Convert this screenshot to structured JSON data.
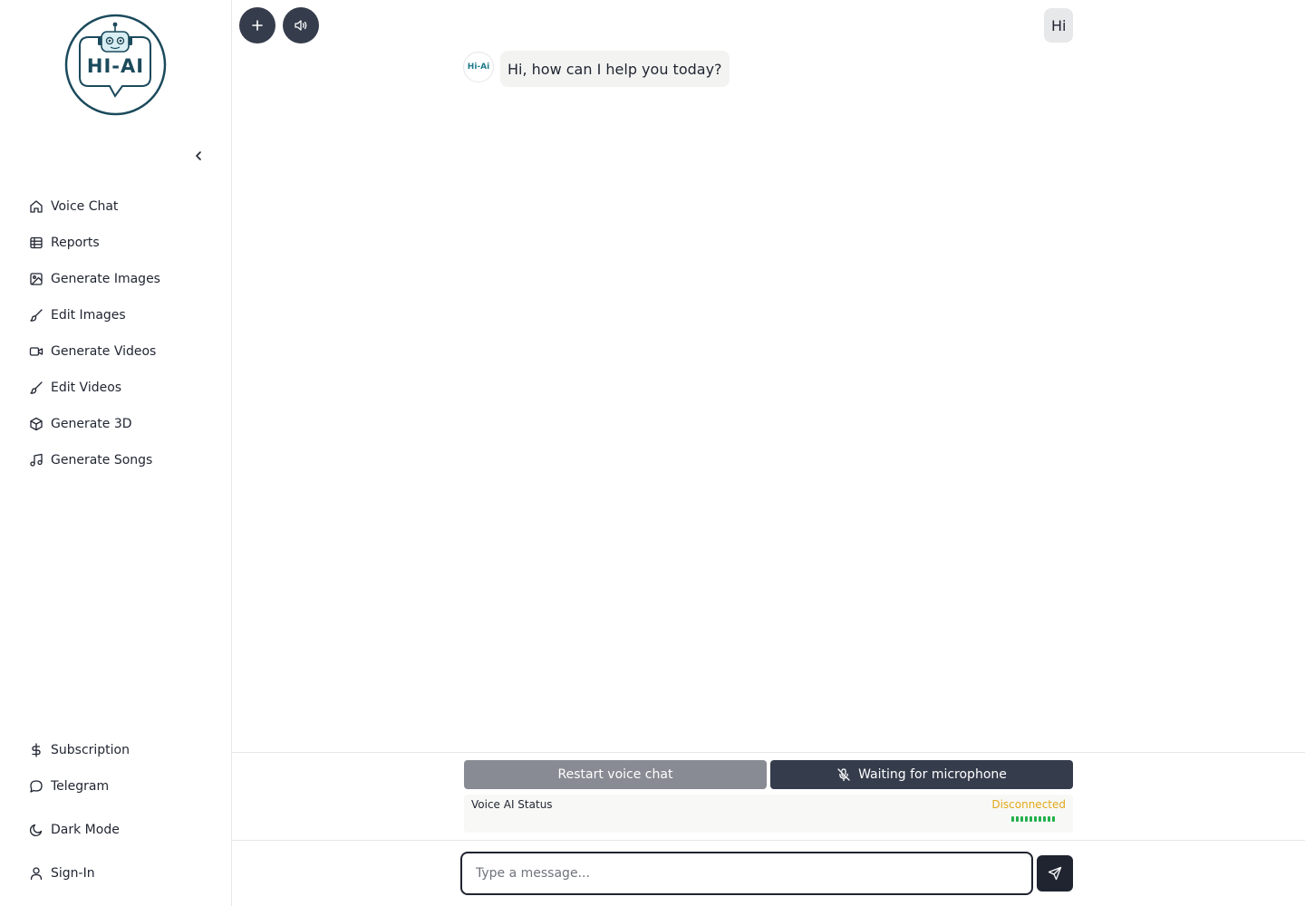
{
  "logo": {
    "text": "HI-AI"
  },
  "sidebar": {
    "items": [
      {
        "label": "Voice Chat",
        "icon": "home-icon"
      },
      {
        "label": "Reports",
        "icon": "table-icon"
      },
      {
        "label": "Generate Images",
        "icon": "image-icon"
      },
      {
        "label": "Edit Images",
        "icon": "brush-icon"
      },
      {
        "label": "Generate Videos",
        "icon": "video-icon"
      },
      {
        "label": "Edit Videos",
        "icon": "brush-icon"
      },
      {
        "label": "Generate 3D",
        "icon": "cube-icon"
      },
      {
        "label": "Generate Songs",
        "icon": "music-icon"
      }
    ],
    "bottom_items": [
      {
        "label": "Subscription",
        "icon": "dollar-icon"
      },
      {
        "label": "Telegram",
        "icon": "chat-bubble-icon"
      },
      {
        "label": "Dark Mode",
        "icon": "moon-icon"
      },
      {
        "label": "Sign-In",
        "icon": "user-icon"
      }
    ]
  },
  "chat": {
    "messages": [
      {
        "role": "user",
        "text": "Hi"
      },
      {
        "role": "assistant",
        "text": "Hi, how can I help you today?",
        "avatar": "Hi-Ai"
      }
    ]
  },
  "voice": {
    "restart_label": "Restart voice chat",
    "mic_label": "Waiting for microphone",
    "status_label": "Voice AI Status",
    "status_value": "Disconnected",
    "status_color": "#e3a817",
    "level_bar_count": 10
  },
  "composer": {
    "placeholder": "Type a message..."
  },
  "colors": {
    "dark_button": "#353c4c",
    "restart_button": "#888b93",
    "level_bar": "#22b04b"
  }
}
